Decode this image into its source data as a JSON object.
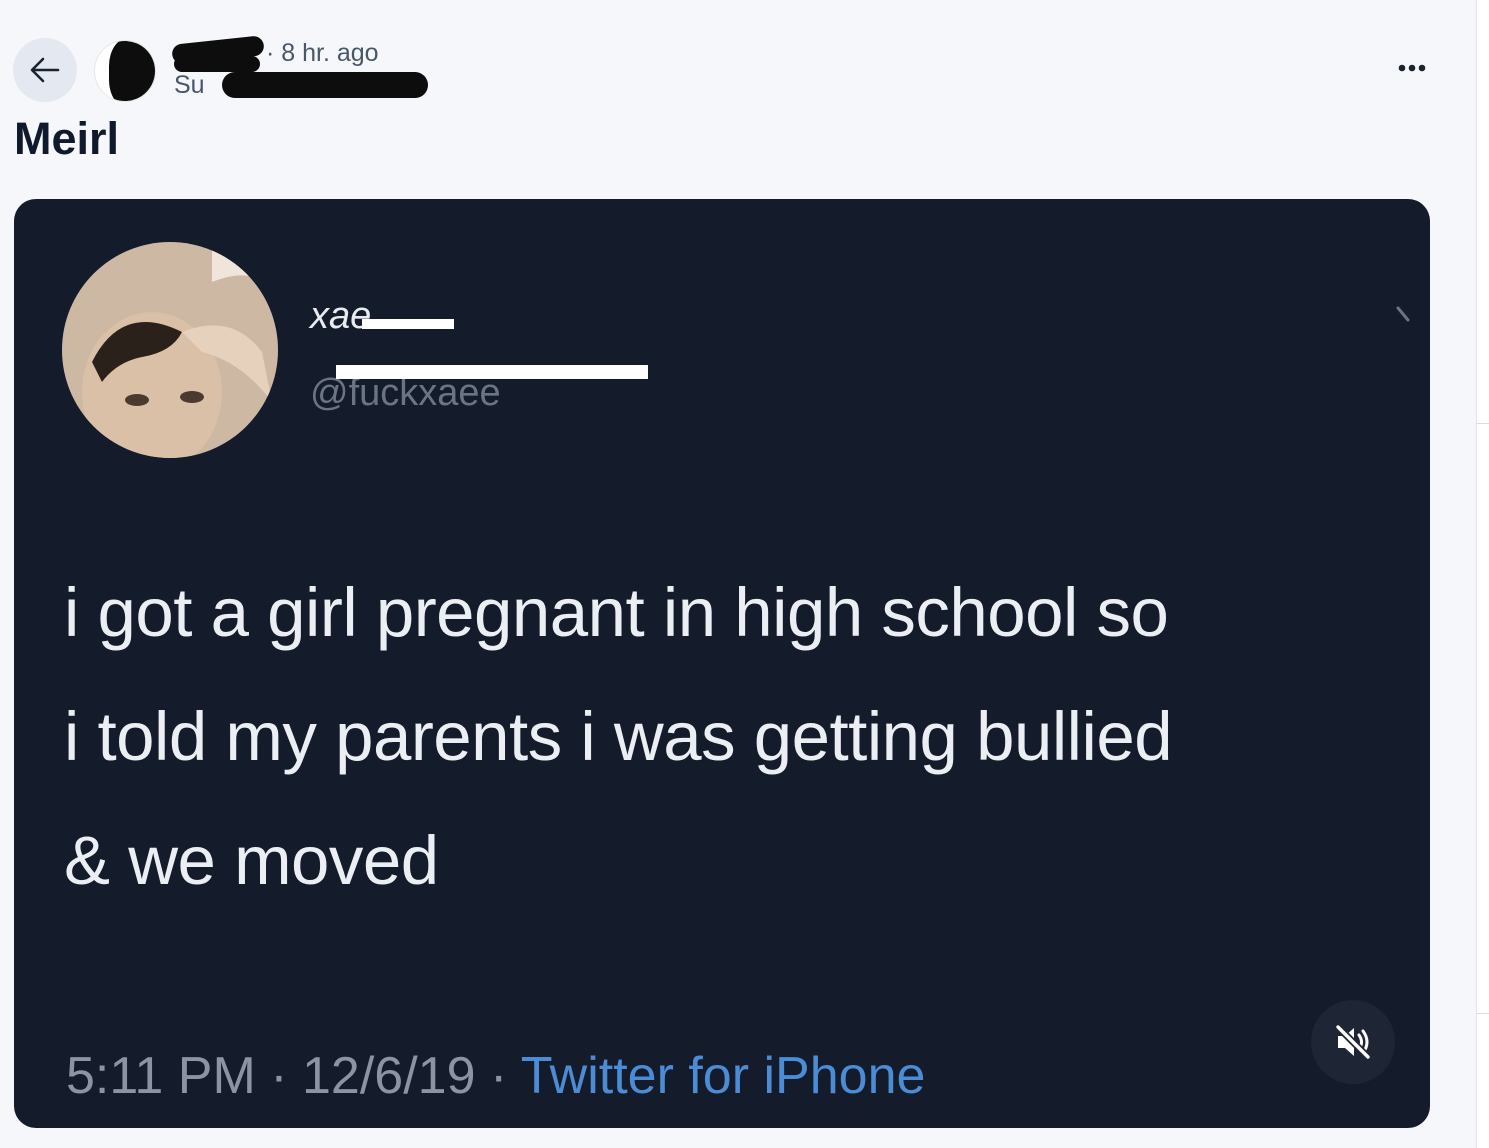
{
  "header": {
    "back_icon": "arrow-left-icon",
    "time_meta": "· 8 hr. ago",
    "community_name": "Su",
    "more_icon": "more-horizontal-icon"
  },
  "post": {
    "title": "Meirl"
  },
  "tweet": {
    "name": "xae",
    "handle": "@fuckxaee",
    "lines": [
      "i got a girl pregnant in high school so",
      "i told my parents i was getting bullied",
      "& we moved"
    ],
    "footer_meta": "5:11 PM · 12/6/19 · ",
    "footer_source": "Twitter for iPhone"
  },
  "video": {
    "mute_icon": "speaker-muted-icon"
  },
  "colors": {
    "background": "#f6f7fb",
    "media_bg": "#141b2b",
    "link_blue": "#4b8cd4",
    "title": "#0f1a2c"
  }
}
